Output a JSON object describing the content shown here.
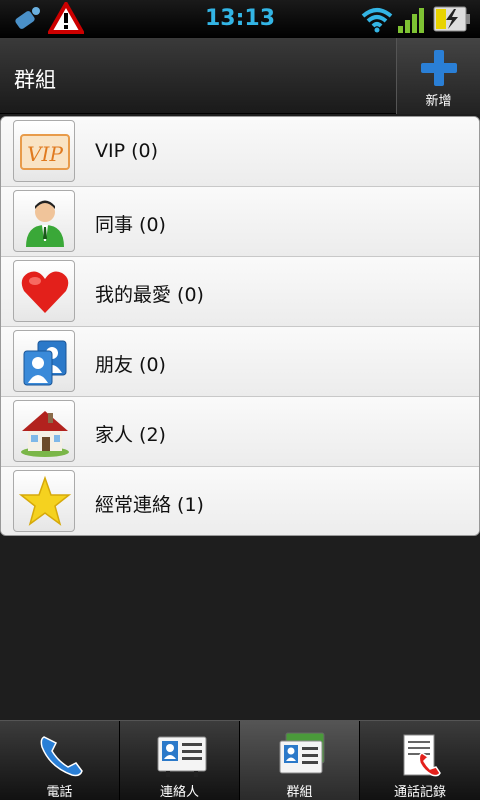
{
  "status_bar": {
    "time": "13:13",
    "icons": [
      "usb-debug-icon",
      "warning-icon",
      "wifi-icon",
      "signal-icon",
      "battery-charging-icon"
    ]
  },
  "header": {
    "title": "群組",
    "add_label": "新增"
  },
  "groups": [
    {
      "label": "VIP (0)",
      "icon": "vip-icon"
    },
    {
      "label": "同事 (0)",
      "icon": "coworker-icon"
    },
    {
      "label": "我的最愛 (0)",
      "icon": "heart-icon"
    },
    {
      "label": "朋友 (0)",
      "icon": "friends-icon"
    },
    {
      "label": "家人 (2)",
      "icon": "house-icon"
    },
    {
      "label": "經常連絡 (1)",
      "icon": "star-icon"
    }
  ],
  "bottom_nav": {
    "tabs": [
      {
        "label": "電話",
        "icon": "phone-icon"
      },
      {
        "label": "連絡人",
        "icon": "contacts-icon"
      },
      {
        "label": "群組",
        "icon": "groups-icon",
        "active": true
      },
      {
        "label": "通話記錄",
        "icon": "call-log-icon"
      }
    ]
  },
  "colors": {
    "time": "#33b5e5",
    "accent_plus": "#2a7fd6"
  }
}
